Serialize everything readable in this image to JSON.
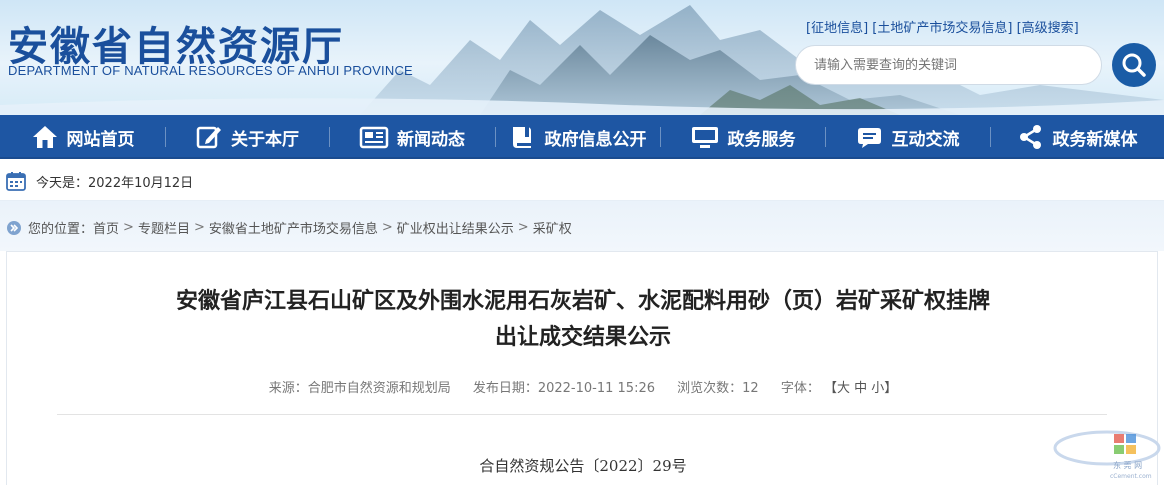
{
  "header": {
    "title": "安徽省自然资源厅",
    "subtitle": "DEPARTMENT OF NATURAL RESOURCES OF ANHUI PROVINCE",
    "links": [
      "[征地信息]",
      "[土地矿产市场交易信息]",
      "[高级搜索]"
    ],
    "search_placeholder": "请输入需要查询的关键词"
  },
  "nav": {
    "items": [
      {
        "label": "网站首页",
        "icon": "home-icon"
      },
      {
        "label": "关于本厅",
        "icon": "edit-icon"
      },
      {
        "label": "新闻动态",
        "icon": "news-icon"
      },
      {
        "label": "政府信息公开",
        "icon": "book-icon"
      },
      {
        "label": "政务服务",
        "icon": "monitor-icon"
      },
      {
        "label": "互动交流",
        "icon": "chat-icon"
      },
      {
        "label": "政务新媒体",
        "icon": "share-icon"
      }
    ]
  },
  "datebar": {
    "text": "今天是：2022年10月12日"
  },
  "breadcrumb": {
    "prefix": "您的位置：",
    "items": [
      "首页",
      "专题栏目",
      "安徽省土地矿产市场交易信息",
      "矿业权出让结果公示",
      "采矿权"
    ],
    "separator": ">"
  },
  "article": {
    "title_line1": "安徽省庐江县石山矿区及外围水泥用石灰岩矿、水泥配料用砂（页）岩矿采矿权挂牌",
    "title_line2": "出让成交结果公示",
    "meta": {
      "source": "来源：合肥市自然资源和规划局",
      "date": "发布日期：2022-10-11 15:26",
      "views": "浏览次数：12",
      "font_label": "字体：",
      "font_sizes": [
        "【大",
        "中",
        "小】"
      ]
    },
    "doc_number": "合自然资规公告〔2022〕29号"
  },
  "watermark": {
    "line1": "东 莞 网",
    "line2": "cCement.com"
  },
  "colors": {
    "primary": "#1e56a3",
    "title": "#1a4f9c"
  }
}
